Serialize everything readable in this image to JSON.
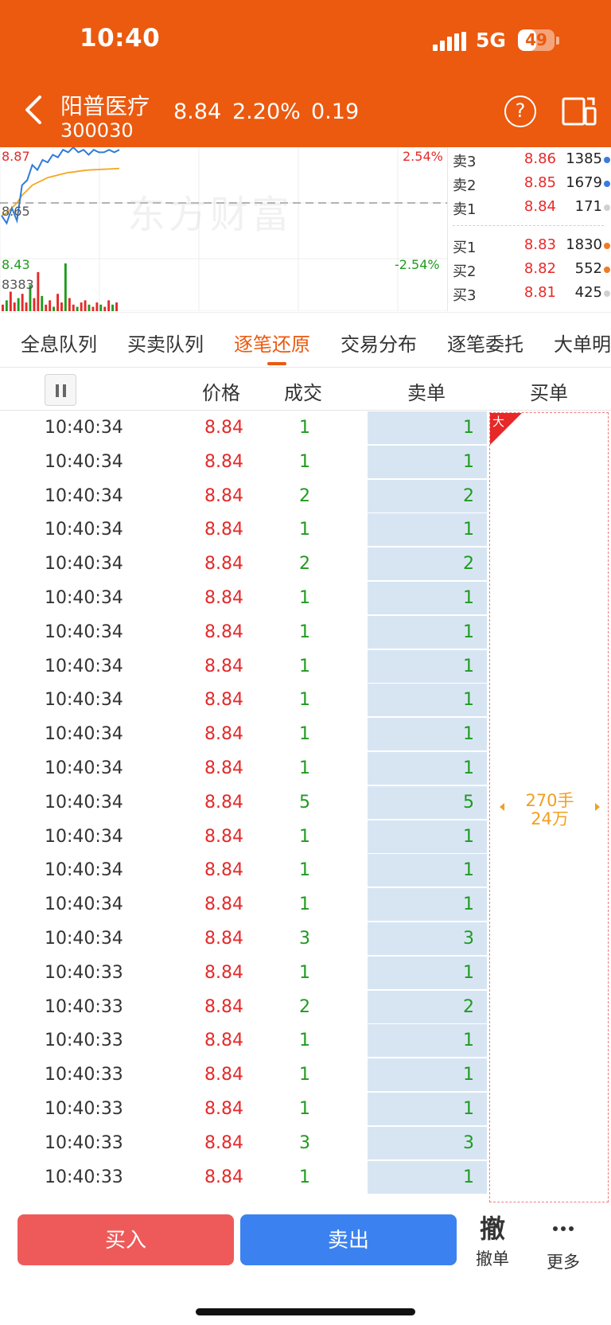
{
  "status": {
    "time": "10:40",
    "network": "5G",
    "battery": "49",
    "battery_level": 0.49
  },
  "header": {
    "name": "阳普医疗",
    "code": "300030",
    "price": "8.84",
    "pct": "2.20%",
    "change": "0.19",
    "help_icon": "?"
  },
  "chart": {
    "high": "8.87",
    "low": "8.43",
    "mid": "8.65",
    "pct_up": "2.54%",
    "pct_down": "-2.54%",
    "volume": "8383",
    "watermark": "东方财富",
    "price_line": [
      8.6,
      8.57,
      8.63,
      8.58,
      8.72,
      8.74,
      8.8,
      8.78,
      8.82,
      8.81,
      8.84,
      8.83,
      8.86,
      8.85,
      8.87,
      8.85,
      8.86,
      8.84,
      8.86,
      8.85,
      8.85,
      8.86,
      8.85,
      8.86
    ],
    "avg_line": [
      8.6,
      8.61,
      8.63,
      8.65,
      8.68,
      8.7,
      8.72,
      8.73,
      8.74,
      8.75,
      8.755,
      8.76,
      8.765,
      8.77,
      8.772,
      8.775,
      8.778,
      8.78,
      8.781,
      8.782,
      8.783,
      8.784,
      8.785,
      8.786
    ],
    "volumes": [
      3,
      5,
      9,
      4,
      6,
      8,
      4,
      12,
      6,
      18,
      7,
      3,
      5,
      2,
      8,
      4,
      22,
      6,
      3,
      2,
      4,
      5,
      3,
      2,
      4,
      3,
      2,
      5,
      3,
      4
    ],
    "colors": {
      "price": "#2F7BD9",
      "avg": "#F5A623",
      "up": "#E52A2A",
      "down": "#1F9B1F"
    }
  },
  "orderbook": {
    "asks": [
      {
        "label": "卖3",
        "price": "8.86",
        "vol": "1385",
        "dot": "#3B7BE0"
      },
      {
        "label": "卖2",
        "price": "8.85",
        "vol": "1679",
        "dot": "#3B7BE0"
      },
      {
        "label": "卖1",
        "price": "8.84",
        "vol": "171",
        "dot": "#d0d0d0"
      }
    ],
    "bids": [
      {
        "label": "买1",
        "price": "8.83",
        "vol": "1830",
        "dot": "#F07B23"
      },
      {
        "label": "买2",
        "price": "8.82",
        "vol": "552",
        "dot": "#F07B23"
      },
      {
        "label": "买3",
        "price": "8.81",
        "vol": "425",
        "dot": "#d0d0d0"
      }
    ]
  },
  "tabs": [
    {
      "label": "全息队列"
    },
    {
      "label": "买卖队列"
    },
    {
      "label": "逐笔还原"
    },
    {
      "label": "交易分布"
    },
    {
      "label": "逐笔委托"
    },
    {
      "label": "大单明"
    }
  ],
  "columns": {
    "price": "价格",
    "volume": "成交",
    "sell": "卖单",
    "buy": "买单"
  },
  "big_order": {
    "badge": "大",
    "hands": "270手",
    "amount": "24万"
  },
  "trades": [
    {
      "time": "10:40:34",
      "price": "8.84",
      "vol": "1",
      "sell": "1"
    },
    {
      "time": "10:40:34",
      "price": "8.84",
      "vol": "1",
      "sell": "1"
    },
    {
      "time": "10:40:34",
      "price": "8.84",
      "vol": "2",
      "sell": "2"
    },
    {
      "time": "10:40:34",
      "price": "8.84",
      "vol": "1",
      "sell": "1"
    },
    {
      "time": "10:40:34",
      "price": "8.84",
      "vol": "2",
      "sell": "2"
    },
    {
      "time": "10:40:34",
      "price": "8.84",
      "vol": "1",
      "sell": "1"
    },
    {
      "time": "10:40:34",
      "price": "8.84",
      "vol": "1",
      "sell": "1"
    },
    {
      "time": "10:40:34",
      "price": "8.84",
      "vol": "1",
      "sell": "1"
    },
    {
      "time": "10:40:34",
      "price": "8.84",
      "vol": "1",
      "sell": "1"
    },
    {
      "time": "10:40:34",
      "price": "8.84",
      "vol": "1",
      "sell": "1"
    },
    {
      "time": "10:40:34",
      "price": "8.84",
      "vol": "1",
      "sell": "1"
    },
    {
      "time": "10:40:34",
      "price": "8.84",
      "vol": "5",
      "sell": "5"
    },
    {
      "time": "10:40:34",
      "price": "8.84",
      "vol": "1",
      "sell": "1"
    },
    {
      "time": "10:40:34",
      "price": "8.84",
      "vol": "1",
      "sell": "1"
    },
    {
      "time": "10:40:34",
      "price": "8.84",
      "vol": "1",
      "sell": "1"
    },
    {
      "time": "10:40:34",
      "price": "8.84",
      "vol": "3",
      "sell": "3"
    },
    {
      "time": "10:40:33",
      "price": "8.84",
      "vol": "1",
      "sell": "1"
    },
    {
      "time": "10:40:33",
      "price": "8.84",
      "vol": "2",
      "sell": "2"
    },
    {
      "time": "10:40:33",
      "price": "8.84",
      "vol": "1",
      "sell": "1"
    },
    {
      "time": "10:40:33",
      "price": "8.84",
      "vol": "1",
      "sell": "1"
    },
    {
      "time": "10:40:33",
      "price": "8.84",
      "vol": "1",
      "sell": "1"
    },
    {
      "time": "10:40:33",
      "price": "8.84",
      "vol": "3",
      "sell": "3"
    },
    {
      "time": "10:40:33",
      "price": "8.84",
      "vol": "1",
      "sell": "1"
    }
  ],
  "actions": {
    "buy": "买入",
    "sell": "卖出",
    "cancel_icon": "撤",
    "cancel": "撤单",
    "more": "更多"
  },
  "theme": {
    "brand": "#EB5A0F",
    "up": "#E52A2A",
    "down": "#1F9B1F",
    "sell_bg": "#D7E5F3"
  }
}
